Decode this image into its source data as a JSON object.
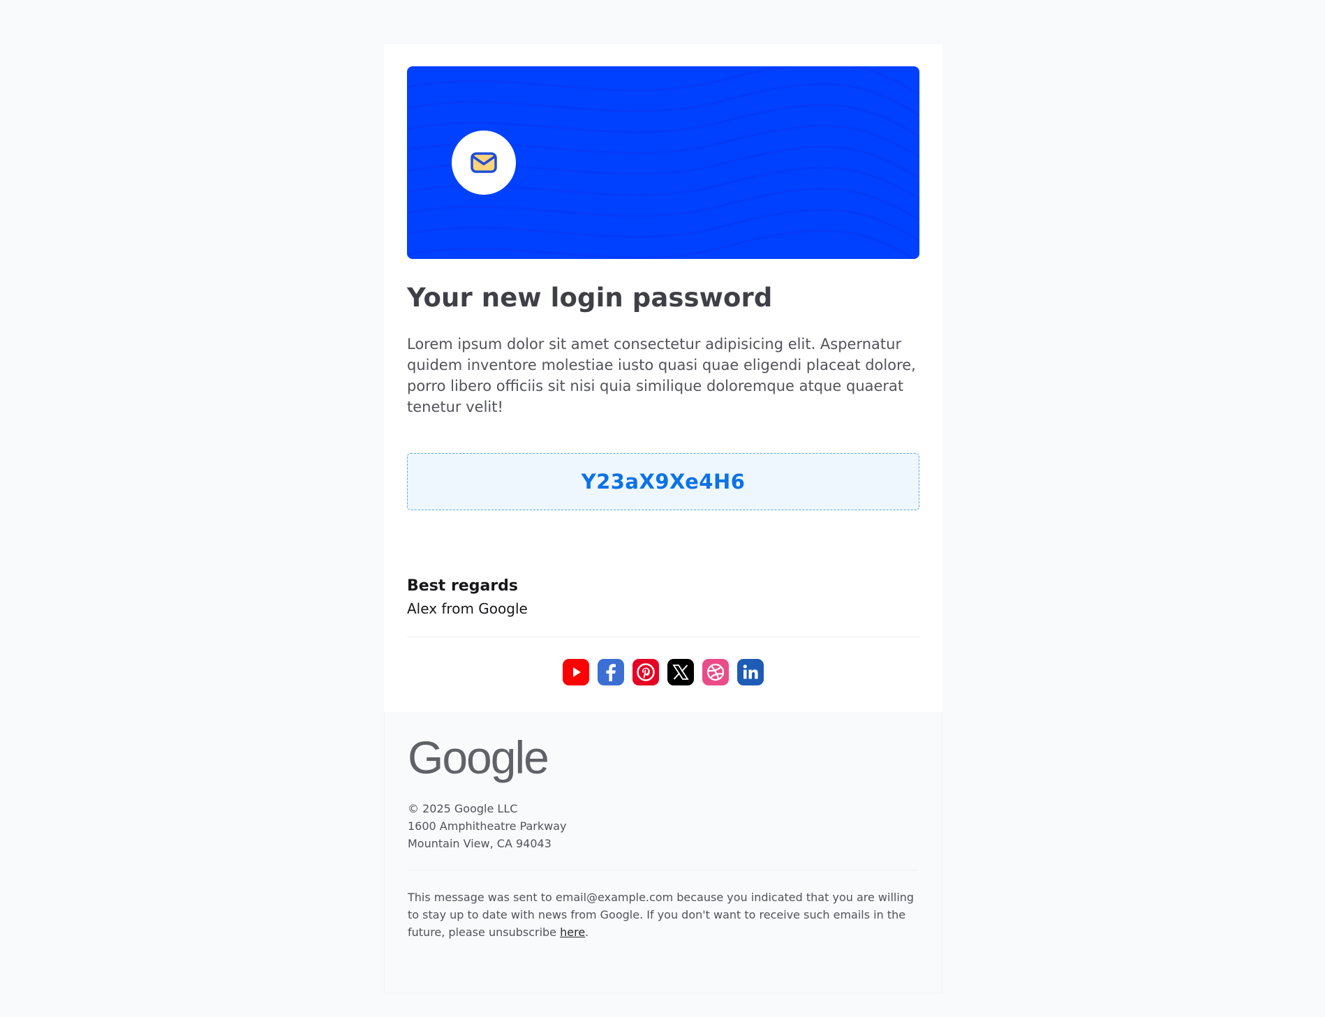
{
  "header": {
    "title": "Your new login password",
    "body": "Lorem ipsum dolor sit amet consectetur adipisicing elit. Aspernatur quidem inventore molestiae iusto quasi quae eligendi placeat dolore, porro libero officiis sit nisi quia similique doloremque atque quaerat tenetur velit!"
  },
  "hero": {
    "background_color": "#0041ff",
    "icon": "envelope-icon"
  },
  "password": {
    "value": "Y23aX9Xe4H6",
    "color": "#0b72e7"
  },
  "signoff": {
    "title": "Best regards",
    "name": "Alex from Google"
  },
  "socials": [
    {
      "icon": "youtube-icon",
      "color": "#ff0000"
    },
    {
      "icon": "facebook-icon",
      "color": "#3b5998"
    },
    {
      "icon": "pinterest-icon",
      "color": "#e60023"
    },
    {
      "icon": "x-icon",
      "color": "#000000"
    },
    {
      "icon": "dribbble-icon",
      "color": "#ea4c89"
    },
    {
      "icon": "linkedin-icon",
      "color": "#0a66c2"
    }
  ],
  "footer": {
    "logo_text": "Google",
    "copyright": "© 2025 Google LLC",
    "address_line1": "1600 Amphitheatre Parkway",
    "address_line2": "Mountain View, CA 94043",
    "notice_text": "This message was sent to email@example.com because you indicated that you are willing to stay up to date with news from Google. If you don't want to receive such emails in the future, please unsubscribe ",
    "unsubscribe_link": "here",
    "notice_end": "."
  }
}
